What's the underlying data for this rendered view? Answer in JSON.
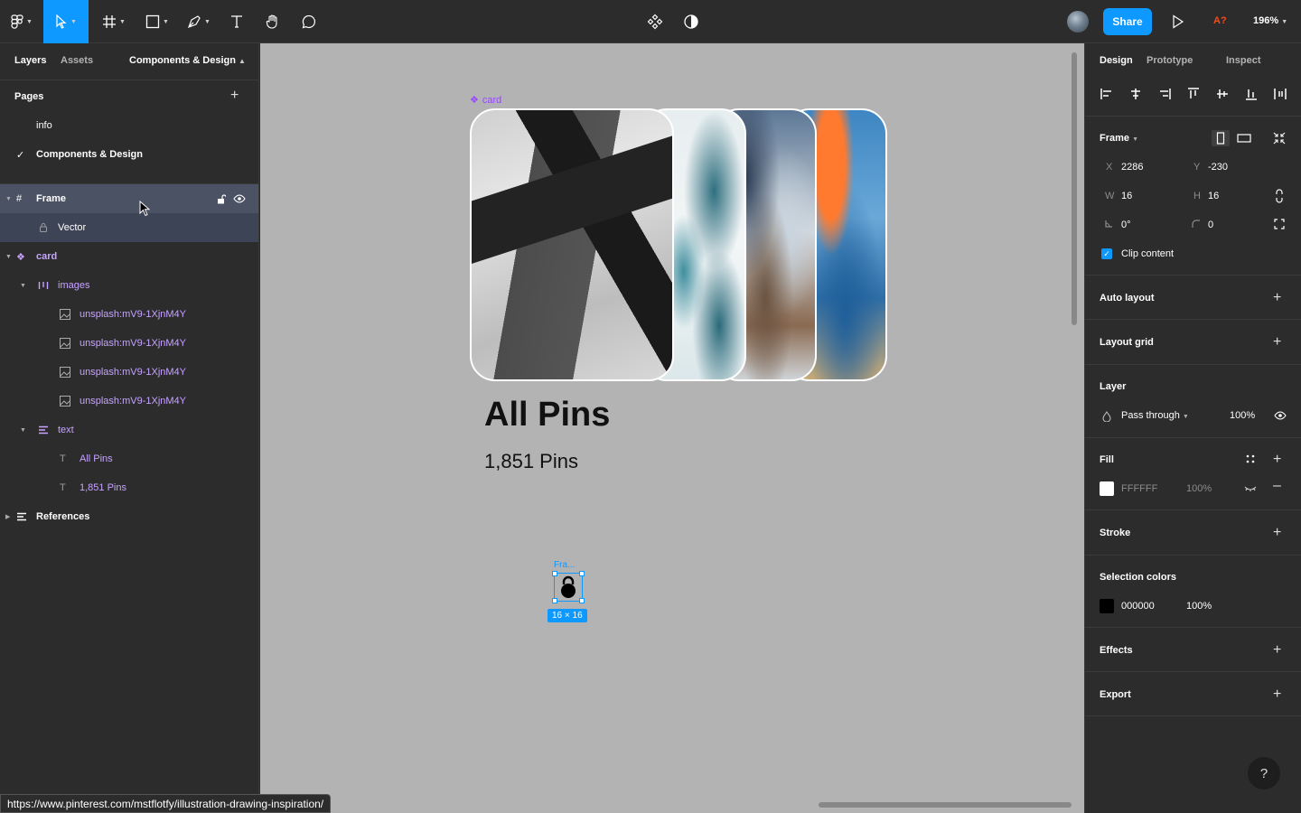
{
  "toolbar": {
    "tools": [
      "main-menu",
      "move",
      "frame",
      "shape",
      "pen",
      "text",
      "hand",
      "comment"
    ],
    "share_label": "Share",
    "user_initials": "A?",
    "zoom": "196%"
  },
  "left_panel": {
    "tabs": [
      "Layers",
      "Assets"
    ],
    "page_selector": "Components & Design",
    "pages_title": "Pages",
    "pages": [
      {
        "name": "info",
        "current": false
      },
      {
        "name": "Components & Design",
        "current": true
      }
    ],
    "layers": [
      {
        "name": "Frame",
        "type": "frame"
      },
      {
        "name": "Vector",
        "type": "vector"
      },
      {
        "name": "card",
        "type": "component"
      },
      {
        "name": "images",
        "type": "autolayout"
      },
      {
        "name": "unsplash:mV9-1XjnM4Y",
        "type": "image"
      },
      {
        "name": "unsplash:mV9-1XjnM4Y",
        "type": "image"
      },
      {
        "name": "unsplash:mV9-1XjnM4Y",
        "type": "image"
      },
      {
        "name": "unsplash:mV9-1XjnM4Y",
        "type": "image"
      },
      {
        "name": "text",
        "type": "autolayout"
      },
      {
        "name": "All Pins",
        "type": "text"
      },
      {
        "name": "1,851 Pins",
        "type": "text"
      },
      {
        "name": "References",
        "type": "section"
      }
    ]
  },
  "canvas": {
    "component_label": "card",
    "card_title": "All Pins",
    "card_subtitle": "1,851 Pins",
    "selected_frame_label": "Fra...",
    "selected_frame_size": "16 × 16",
    "status_url": "https://www.pinterest.com/mstflotfy/illustration-drawing-inspiration/"
  },
  "right_panel": {
    "tabs": [
      "Design",
      "Prototype",
      "Inspect"
    ],
    "frame_title": "Frame",
    "x_label": "X",
    "x_value": "2286",
    "y_label": "Y",
    "y_value": "-230",
    "w_label": "W",
    "w_value": "16",
    "h_label": "H",
    "h_value": "16",
    "rotation_value": "0°",
    "radius_value": "0",
    "clip_content_label": "Clip content",
    "auto_layout_title": "Auto layout",
    "layout_grid_title": "Layout grid",
    "layer_title": "Layer",
    "blend_mode": "Pass through",
    "layer_opacity": "100%",
    "fill_title": "Fill",
    "fill_hex": "FFFFFF",
    "fill_opacity": "100%",
    "stroke_title": "Stroke",
    "selection_colors_title": "Selection colors",
    "selection_color_hex": "000000",
    "selection_color_opacity": "100%",
    "effects_title": "Effects",
    "export_title": "Export",
    "help_label": "?"
  },
  "colors": {
    "accent": "#0d99ff",
    "component_purple": "#9747ff",
    "panel_bg": "#2c2c2c",
    "canvas_bg": "#b3b3b3"
  }
}
